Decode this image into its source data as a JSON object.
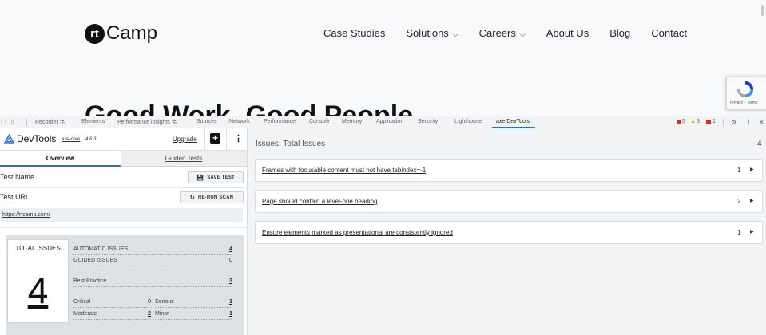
{
  "site": {
    "logo_mark": "rt",
    "logo_word": "Camp",
    "nav": [
      {
        "label": "Case Studies",
        "dropdown": false
      },
      {
        "label": "Solutions",
        "dropdown": true
      },
      {
        "label": "Careers",
        "dropdown": true
      },
      {
        "label": "About Us",
        "dropdown": false
      },
      {
        "label": "Blog",
        "dropdown": false
      },
      {
        "label": "Contact",
        "dropdown": false
      }
    ],
    "hero_title": "Good Work. Good People.",
    "recaptcha_text": "Privacy - Terms"
  },
  "devtools": {
    "tabs": [
      "Recorder",
      "Elements",
      "Performance insights",
      "Sources",
      "Network",
      "Performance",
      "Console",
      "Memory",
      "Application",
      "Security",
      "Lighthouse",
      "axe DevTools"
    ],
    "active_tab": "axe DevTools",
    "errors": "5",
    "warnings": "3",
    "issues": "1"
  },
  "axe": {
    "title": "DevTools",
    "version_name": "axe-core",
    "version": "4.6.3",
    "upgrade": "Upgrade",
    "tabs": {
      "overview": "Overview",
      "guided": "Guided Tests"
    },
    "test_name_label": "Test Name",
    "save_test": "SAVE TEST",
    "test_url_label": "Test URL",
    "rerun_scan": "RE-RUN SCAN",
    "url": "https://rtcamp.com/",
    "total_issues_label": "TOTAL ISSUES",
    "total_issues": "4",
    "automatic_label": "AUTOMATIC ISSUES",
    "automatic": "4",
    "guided_label": "GUIDED ISSUES",
    "guided": "0",
    "best_practice_label": "Best Practice",
    "best_practice": "3",
    "critical_label": "Critical",
    "critical": "0",
    "serious_label": "Serious",
    "serious": "1",
    "moderate_label": "Moderate",
    "moderate": "2",
    "minor_label": "Minor",
    "minor": "1"
  },
  "issues_panel": {
    "title": "Issues: Total Issues",
    "count": "4",
    "items": [
      {
        "text": "Frames with focusable content must not have tabindex=-1",
        "count": "1"
      },
      {
        "text": "Page should contain a level-one heading",
        "count": "2"
      },
      {
        "text": "Ensure elements marked as presentational are consistently ignored",
        "count": "1"
      }
    ]
  },
  "colors": {
    "accent": "#1a73e8",
    "error": "#d93025",
    "warning": "#f9ab00"
  }
}
